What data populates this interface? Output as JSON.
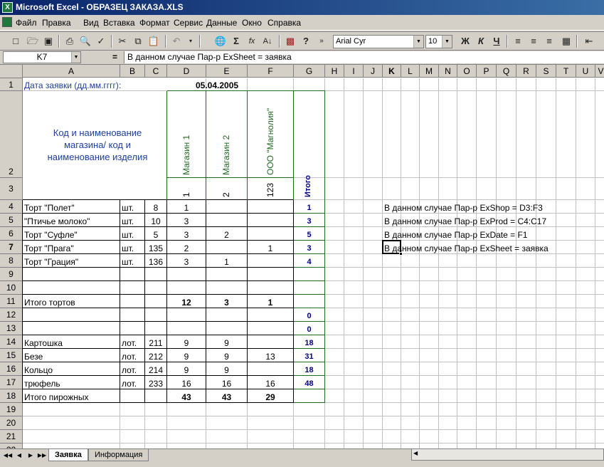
{
  "window": {
    "title": "Microsoft Excel - ОБРАЗЕЦ ЗАКАЗА.XLS",
    "app_icon": "X"
  },
  "menu": [
    "Файл",
    "Правка",
    "Вид",
    "Вставка",
    "Формат",
    "Сервис",
    "Данные",
    "Окно",
    "Справка"
  ],
  "toolbar": {
    "font_name": "Arial Cyr",
    "font_size": "10",
    "bold_label": "Ж",
    "italic_label": "К",
    "underline_label": "Ч",
    "icons": [
      "new-icon",
      "open-icon",
      "save-icon",
      "print-icon",
      "print-preview-icon",
      "spellcheck-icon",
      "cut-icon",
      "copy-icon",
      "paste-icon",
      "undo-icon",
      "web-icon",
      "autosum-icon",
      "function-icon",
      "sort-icon",
      "chart-icon",
      "help-icon",
      "more-icon",
      "align-left-icon",
      "align-center-icon",
      "align-right-icon",
      "merge-icon",
      "indent-icon"
    ]
  },
  "formula_bar": {
    "name_box": "K7",
    "eq": "=",
    "formula": "В данном случае Пар-р ExSheet = заявка"
  },
  "columns": [
    "A",
    "B",
    "C",
    "D",
    "E",
    "F",
    "G",
    "H",
    "I",
    "J",
    "K",
    "L",
    "M",
    "N",
    "O",
    "P",
    "Q",
    "R",
    "S",
    "T",
    "U",
    "V"
  ],
  "selected_column": "K",
  "rows": [
    "1",
    "2",
    "3",
    "4",
    "5",
    "6",
    "7",
    "8",
    "9",
    "10",
    "11",
    "12",
    "13",
    "14",
    "15",
    "16",
    "17",
    "18",
    "19",
    "20",
    "21",
    "22"
  ],
  "selected_row": "7",
  "sheet": {
    "a1": "Дата заявки (дд.мм.гггг):",
    "f1": "05.04.2005",
    "header_line1": "Код и наименование",
    "header_line2": "магазина/     код и",
    "header_line3": "наименование изделия",
    "d2": "Магазин 1",
    "e2": "Магазин 2",
    "f2": "ООО \"Магнолия\"",
    "d3": "1",
    "e3": "2",
    "f3": "123",
    "g3": "Итого",
    "items": [
      {
        "row": "4",
        "name": "Торт \"Полет\"",
        "unit": "шт.",
        "code": "8",
        "d": "1",
        "e": "",
        "f": "",
        "g": "1"
      },
      {
        "row": "5",
        "name": "\"Птичье молоко\"",
        "unit": "шт.",
        "code": "10",
        "d": "3",
        "e": "",
        "f": "",
        "g": "3"
      },
      {
        "row": "6",
        "name": "Торт \"Суфле\"",
        "unit": "шт.",
        "code": "5",
        "d": "3",
        "e": "2",
        "f": "",
        "g": "5"
      },
      {
        "row": "7",
        "name": "Торт \"Прага\"",
        "unit": "шт.",
        "code": "135",
        "d": "2",
        "e": "",
        "f": "1",
        "g": "3"
      },
      {
        "row": "8",
        "name": "Торт \"Грация\"",
        "unit": "шт.",
        "code": "136",
        "d": "3",
        "e": "1",
        "f": "",
        "g": "4"
      },
      {
        "row": "11",
        "name": "Итого тортов",
        "unit": "",
        "code": "",
        "d": "12",
        "e": "3",
        "f": "1",
        "g": ""
      },
      {
        "row": "12",
        "name": "",
        "unit": "",
        "code": "",
        "d": "",
        "e": "",
        "f": "",
        "g": "0"
      },
      {
        "row": "13",
        "name": "",
        "unit": "",
        "code": "",
        "d": "",
        "e": "",
        "f": "",
        "g": "0"
      },
      {
        "row": "14",
        "name": "Картошка",
        "unit": "лот.",
        "code": "211",
        "d": "9",
        "e": "9",
        "f": "",
        "g": "18"
      },
      {
        "row": "15",
        "name": "Безе",
        "unit": "лот.",
        "code": "212",
        "d": "9",
        "e": "9",
        "f": "13",
        "g": "31"
      },
      {
        "row": "16",
        "name": "Кольцо",
        "unit": "лот.",
        "code": "214",
        "d": "9",
        "e": "9",
        "f": "",
        "g": "18"
      },
      {
        "row": "17",
        "name": "трюфель",
        "unit": "лот.",
        "code": "233",
        "d": "16",
        "e": "16",
        "f": "16",
        "g": "48"
      },
      {
        "row": "18",
        "name": "Итого пирожных",
        "unit": "",
        "code": "",
        "d": "43",
        "e": "43",
        "f": "29",
        "g": ""
      }
    ],
    "notes": [
      "В данном случае Пар-р ExShop = D3:F3",
      "В данном случае Пар-р ExProd = C4:C17",
      "В данном случае Пар-р ExDate = F1",
      "В данном случае Пар-р ExSheet = заявка"
    ]
  },
  "tabs": [
    "Заявка",
    "Информация"
  ],
  "active_tab": "Заявка",
  "colors": {
    "title_start": "#0a246a",
    "title_end": "#3a6ea5",
    "header_text": "#000080",
    "vertical_text": "#1f6b1f",
    "grid": "#c0c0c0",
    "chrome": "#d4d0c8"
  }
}
